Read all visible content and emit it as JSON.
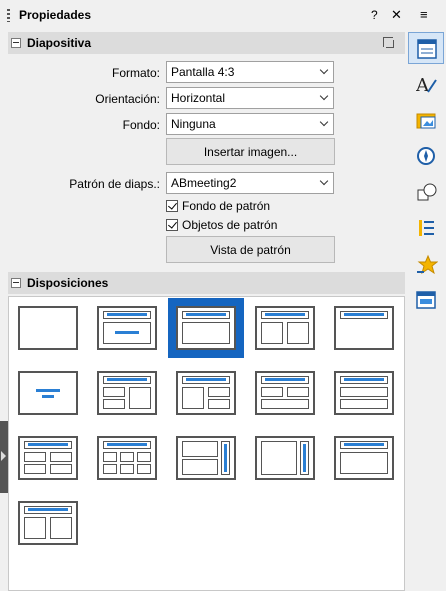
{
  "window": {
    "title": "Propiedades",
    "help_label": "?",
    "close_label": "✕",
    "menu_label": "≡"
  },
  "slide_section": {
    "title": "Diapositiva",
    "format_label": "Formato:",
    "format_value": "Pantalla 4:3",
    "orientation_label": "Orientación:",
    "orientation_value": "Horizontal",
    "background_label": "Fondo:",
    "background_value": "Ninguna",
    "insert_image_label": "Insertar imagen...",
    "master_label": "Patrón de diaps.:",
    "master_value": "ABmeeting2",
    "master_background_label": "Fondo de patrón",
    "master_background_checked": true,
    "master_objects_label": "Objetos de patrón",
    "master_objects_checked": true,
    "master_view_label": "Vista de patrón"
  },
  "layouts_section": {
    "title": "Disposiciones",
    "selected_index": 2,
    "layouts": [
      "blank",
      "title-content",
      "title-content-selected",
      "title-two-content",
      "title-only",
      "centered-text",
      "title-two-content-alt",
      "title-two-content-2",
      "title-content-two",
      "title-content-stack",
      "title-4-content",
      "title-6-content",
      "vertical-title-text",
      "vertical-title-content",
      "title-vertical-text",
      "title-two-content-footer"
    ]
  },
  "sidebar_tabs": [
    {
      "name": "properties-icon",
      "active": true
    },
    {
      "name": "styles-icon",
      "active": false
    },
    {
      "name": "gallery-icon",
      "active": false
    },
    {
      "name": "navigator-icon",
      "active": false
    },
    {
      "name": "shapes-icon",
      "active": false
    },
    {
      "name": "slide-transition-icon",
      "active": false
    },
    {
      "name": "animation-icon",
      "active": false
    },
    {
      "name": "master-slides-icon",
      "active": false
    }
  ],
  "colors": {
    "accent": "#1565c0",
    "bar": "#2a7fd4"
  }
}
